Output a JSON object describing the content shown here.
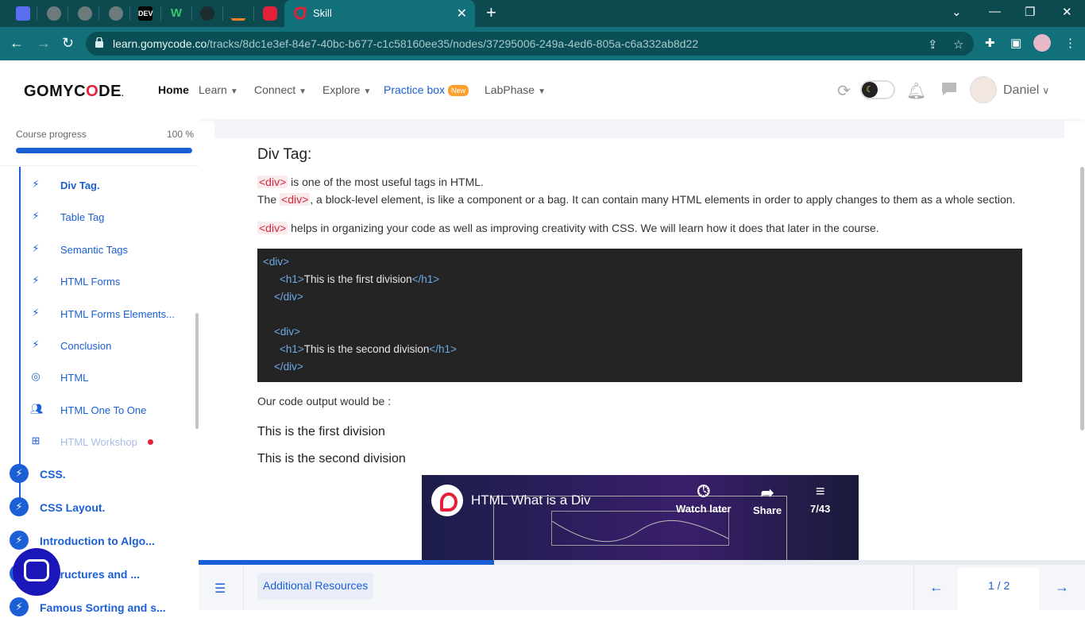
{
  "browser": {
    "tabs": [
      {
        "icon": "calendar-app-icon"
      },
      {
        "icon": "globe-icon"
      },
      {
        "icon": "globe-icon"
      },
      {
        "icon": "globe-icon"
      },
      {
        "label": "DEV"
      },
      {
        "label": "W"
      },
      {
        "icon": "github-icon"
      },
      {
        "icon": "stackoverflow-icon"
      },
      {
        "icon": "gomycode-icon"
      }
    ],
    "active_tab": {
      "title": "Skill",
      "close": "✕"
    },
    "new_tab": "+",
    "url_host": "learn.gomycode.co",
    "url_path": "/tracks/8dc1e3ef-84e7-40bc-b677-c1c58160ee35/nodes/37295006-249a-4ed6-805a-c6a332ab8d22"
  },
  "header": {
    "logo_pre": "GOMYC",
    "logo_o": "O",
    "logo_post": "DE",
    "logo_mark": ".",
    "nav": {
      "home": "Home",
      "learn": "Learn",
      "connect": "Connect",
      "explore": "Explore",
      "practice": "Practice box",
      "practice_badge": "New",
      "labphase": "LabPhase"
    },
    "user_name": "Daniel"
  },
  "sidebar": {
    "progress_label": "Course progress",
    "progress_value": "100 %",
    "progress_fraction": 1.0,
    "items": [
      {
        "label": "Div Tag.",
        "icon": "bolt-icon",
        "active": true
      },
      {
        "label": "Table Tag",
        "icon": "bolt-icon"
      },
      {
        "label": "Semantic Tags",
        "icon": "bolt-icon"
      },
      {
        "label": "HTML Forms",
        "icon": "bolt-icon"
      },
      {
        "label": "HTML Forms Elements...",
        "icon": "bolt-icon"
      },
      {
        "label": "Conclusion",
        "icon": "bolt-icon"
      },
      {
        "label": "HTML",
        "icon": "target-icon"
      },
      {
        "label": "HTML One To One",
        "icon": "people-icon"
      },
      {
        "label": "HTML Workshop",
        "icon": "workshop-icon",
        "muted": true
      }
    ],
    "sections": [
      {
        "label": "CSS."
      },
      {
        "label": "CSS Layout."
      },
      {
        "label": "Introduction to Algo..."
      },
      {
        "label": "a Structures and ..."
      },
      {
        "label": "Famous Sorting and s..."
      }
    ]
  },
  "content": {
    "title": "Div Tag:",
    "p1_tag": "<div>",
    "p1_text": " is one of the most useful tags in HTML.",
    "p2_pre": "The ",
    "p2_tag": "<div>",
    "p2_text": ", a block-level element, is like a component or a bag. It can contain many HTML elements in order to apply changes to them as a whole section.",
    "p3_tag": "<div>",
    "p3_text": " helps in organizing your code as well as improving creativity with CSS. We will learn how it does that later in the course.",
    "code": {
      "l1_open": "<div>",
      "l2_open": "<h1>",
      "l2_text": "This is the first division",
      "l2_close": "</h1>",
      "l3_close": "</div>",
      "l4_open": "<div>",
      "l5_open": "<h1>",
      "l5_text": "This is the second division",
      "l5_close": "</h1>",
      "l6_close": "</div>"
    },
    "output_label": "Our code output would be :",
    "output_1": "This is the first division",
    "output_2": "This is the second division",
    "video": {
      "title": "HTML What is a Div",
      "watch_later": "Watch later",
      "share": "Share",
      "playlist_count": "7/43"
    }
  },
  "bottom_bar": {
    "resources": "Additional Resources",
    "page": "1 / 2",
    "progress_fraction": 0.333
  }
}
